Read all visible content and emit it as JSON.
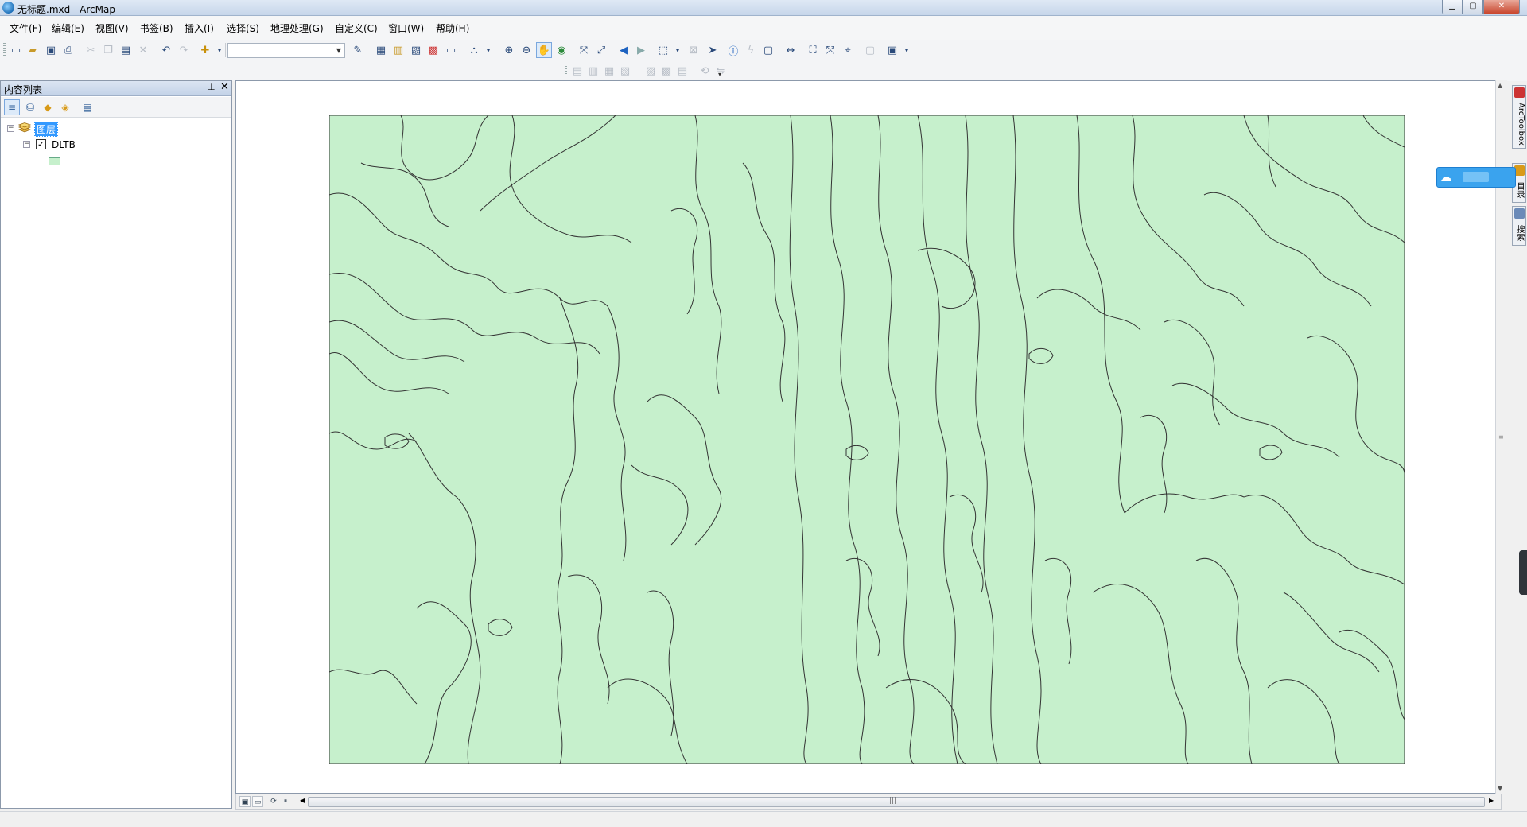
{
  "window": {
    "title": "无标题.mxd - ArcMap"
  },
  "menu": {
    "items": [
      "文件(F)",
      "编辑(E)",
      "视图(V)",
      "书签(B)",
      "插入(I)",
      "选择(S)",
      "地理处理(G)",
      "自定义(C)",
      "窗口(W)",
      "帮助(H)"
    ]
  },
  "toc": {
    "title": "内容列表",
    "group_label": "图层",
    "layer_name": "DLTB",
    "layer_checked": true
  },
  "dock": {
    "tab1": "ArcToolbox",
    "tab2": "目录",
    "tab3": "搜索"
  },
  "map": {
    "fill": "#c6f0cc",
    "stroke": "#333333"
  },
  "colors": {
    "selection": "#3399ff",
    "cloud_widget": "#3aa3ee"
  },
  "icons": [
    "new-document-icon",
    "open-icon",
    "save-icon",
    "print-icon",
    "cut-icon",
    "copy-icon",
    "paste-icon",
    "delete-icon",
    "undo-icon",
    "redo-icon",
    "add-data-icon",
    "zoom-in-icon",
    "zoom-out-icon",
    "pan-icon",
    "full-extent-icon",
    "identify-icon",
    "find-icon",
    "select-icon"
  ]
}
